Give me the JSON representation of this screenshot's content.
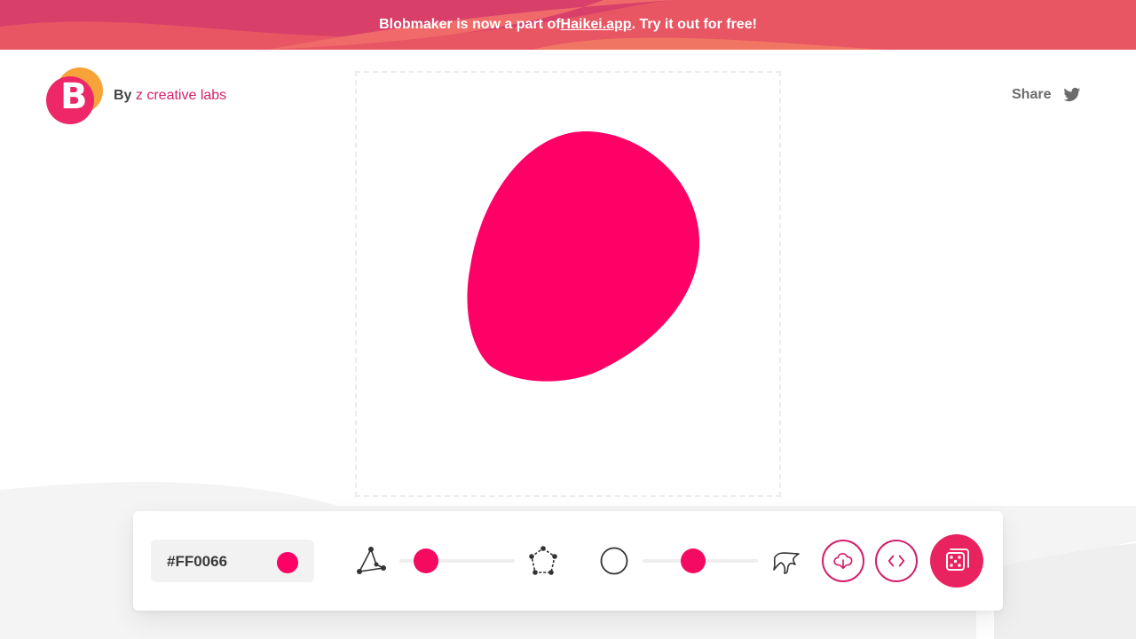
{
  "banner": {
    "prefix": "Blobmaker is now a part of ",
    "link": "Haikei.app",
    "suffix": ". Try it out for free!"
  },
  "brand": {
    "logo_letter": "B",
    "by": "By",
    "lab": "z creative labs"
  },
  "share": {
    "label": "Share",
    "icon": "twitter-icon"
  },
  "blob": {
    "color": "#FF0066"
  },
  "toolbar": {
    "color_value": "#FF0066",
    "swatch_color": "#FF0066",
    "complexity": {
      "min_icon": "triangle-nodes-icon",
      "max_icon": "pentagon-nodes-icon",
      "level": 0.23
    },
    "contrast": {
      "min_icon": "circle-outline-icon",
      "max_icon": "spiky-blob-icon",
      "level": 0.44
    },
    "download_icon": "cloud-download-icon",
    "code_icon": "code-brackets-icon",
    "random_icon": "dice-icon"
  },
  "colors": {
    "accent": "#d41f6b",
    "knob": "#f50a62",
    "banner": "#e85563"
  }
}
